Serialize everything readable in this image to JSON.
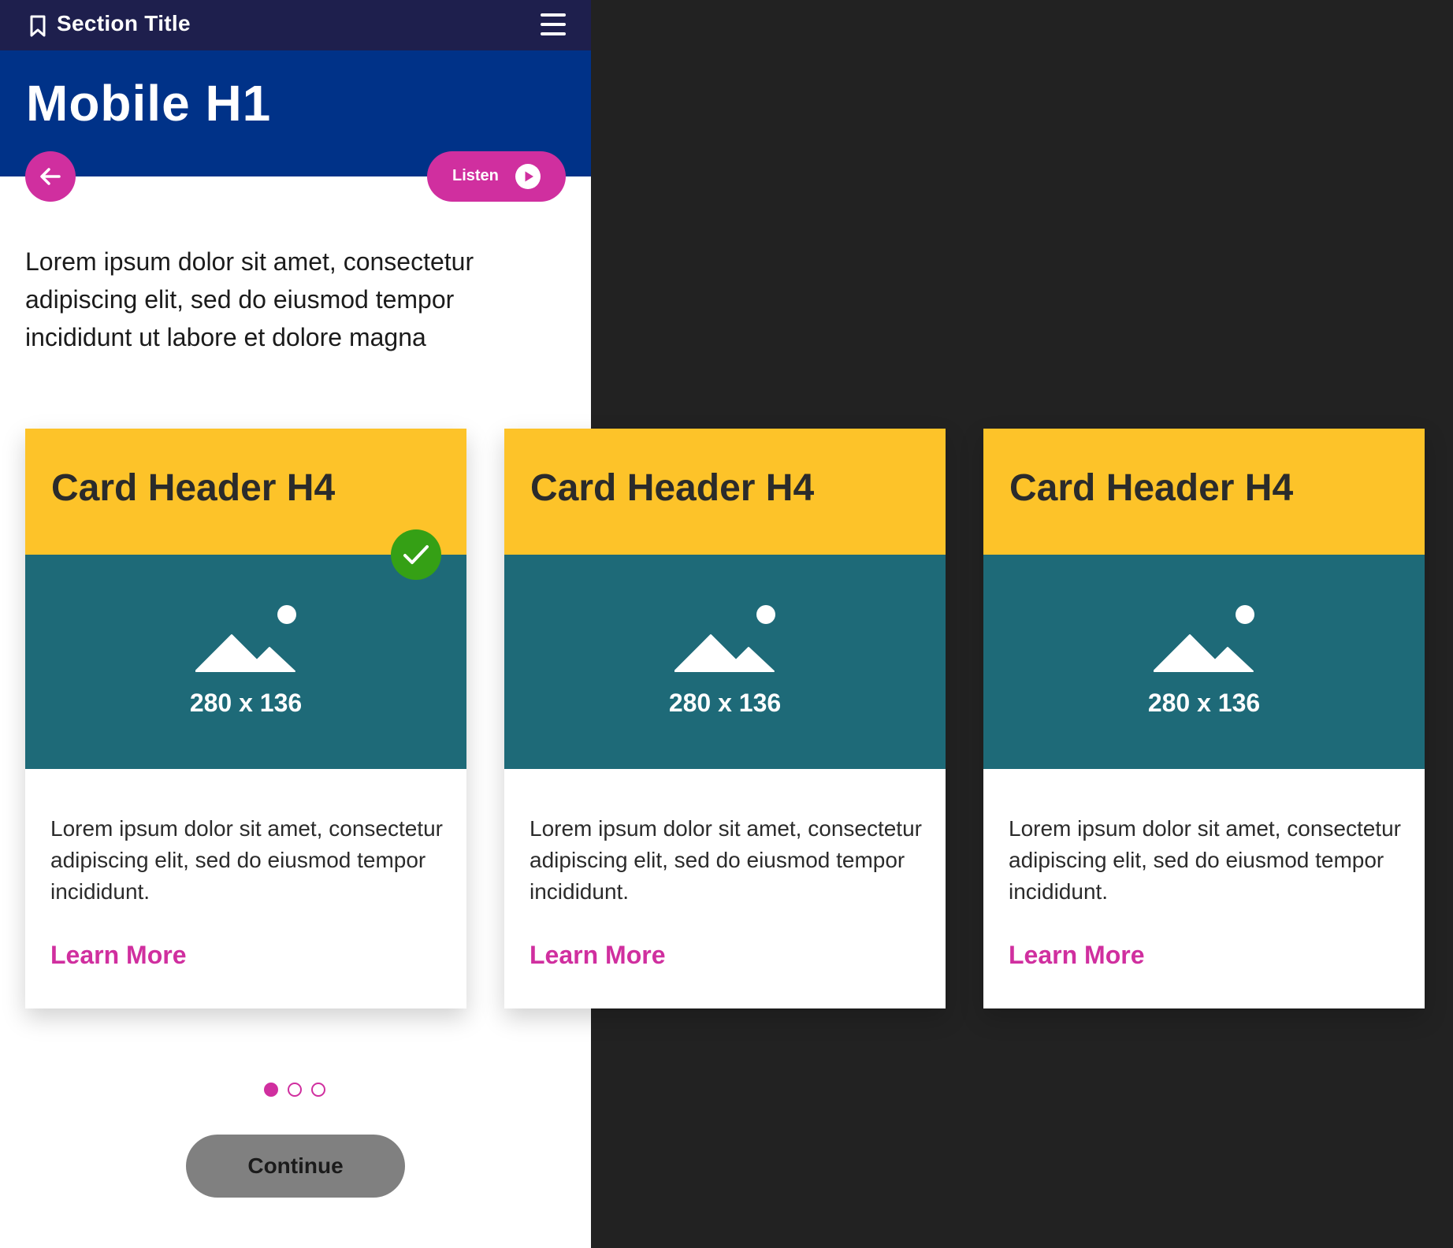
{
  "topbar": {
    "section_title": "Section Title",
    "bookmark_icon": "bookmark-icon",
    "menu_icon": "hamburger-menu-icon"
  },
  "hero": {
    "title": "Mobile H1"
  },
  "actions": {
    "back_icon": "arrow-left-icon",
    "listen_label": "Listen",
    "listen_icon": "play-circle-icon"
  },
  "intro_text": "Lorem ipsum dolor sit amet, consectetur adipiscing elit, sed do eiusmod tempor incididunt ut labore et dolore magna",
  "cards": [
    {
      "header": "Card Header H4",
      "image_label": "280 x 136",
      "body": "Lorem ipsum dolor sit amet, consectetur adipiscing elit, sed do eiusmod tempor incididunt.",
      "link": "Learn More",
      "selected": true
    },
    {
      "header": "Card Header H4",
      "image_label": "280 x 136",
      "body": "Lorem ipsum dolor sit amet, consectetur adipiscing elit, sed do eiusmod tempor incididunt.",
      "link": "Learn More",
      "selected": false
    },
    {
      "header": "Card Header H4",
      "image_label": "280 x 136",
      "body": "Lorem ipsum dolor sit amet, consectetur adipiscing elit, sed do eiusmod tempor incididunt.",
      "link": "Learn More",
      "selected": false
    }
  ],
  "pagination": {
    "total": 3,
    "active_index": 0
  },
  "continue_label": "Continue",
  "colors": {
    "topbar": "#1e1f4d",
    "hero": "#003288",
    "accent": "#d02f9f",
    "card_header": "#fdc329",
    "card_image": "#1e6a78",
    "check": "#35a015",
    "continue_button": "#808080",
    "backdrop": "#222222"
  }
}
